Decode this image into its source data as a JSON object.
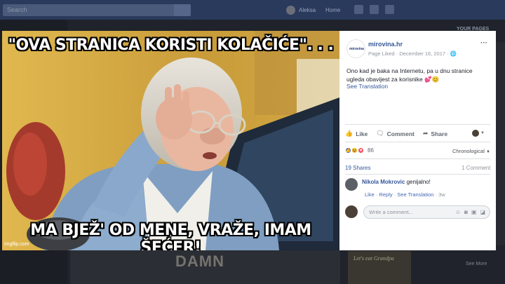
{
  "topbar": {
    "search_placeholder": "Search",
    "user_name": "Aleksa",
    "home_label": "Home"
  },
  "background": {
    "your_pages": "YOUR PAGES",
    "damn_text": "DAMN",
    "card_text": "Let's eat Grandpa",
    "side_small": "See More"
  },
  "photo": {
    "top_caption": "\"OVA STRANICA KORISTI KOLAČIĆE\". . .",
    "bottom_caption": "MA BJEŽ' OD MENE, VRAŽE, IMAM ŠEĆER!",
    "watermark": "imgflip.com"
  },
  "post": {
    "logo_text": "mirovina",
    "page_name": "mirovina.hr",
    "meta": "Page Liked · December 16, 2017 · ",
    "globe_icon": "globe-icon",
    "text": "Ono kad je baka na Internetu, pa u dnu stranice ugleda obavijest za korisnike 💕😊",
    "see_translation": "See Translation",
    "more": "···"
  },
  "actions": {
    "like": "Like",
    "comment": "Comment",
    "share": "Share"
  },
  "reactions": {
    "count": "86",
    "order": "Chronological"
  },
  "stats": {
    "shares": "19 Shares",
    "comments": "1 Comment"
  },
  "comment": {
    "author": "Nikola Mokrovic",
    "text": " genijalno!",
    "like": "Like",
    "reply": "Reply",
    "see_translation": "See Translation",
    "time": "3w"
  },
  "composer": {
    "placeholder": "Write a comment..."
  },
  "colors": {
    "accent": "#365899",
    "like_blue": "#4267b2",
    "love_red": "#f25268",
    "haha_yellow": "#f7b125"
  }
}
